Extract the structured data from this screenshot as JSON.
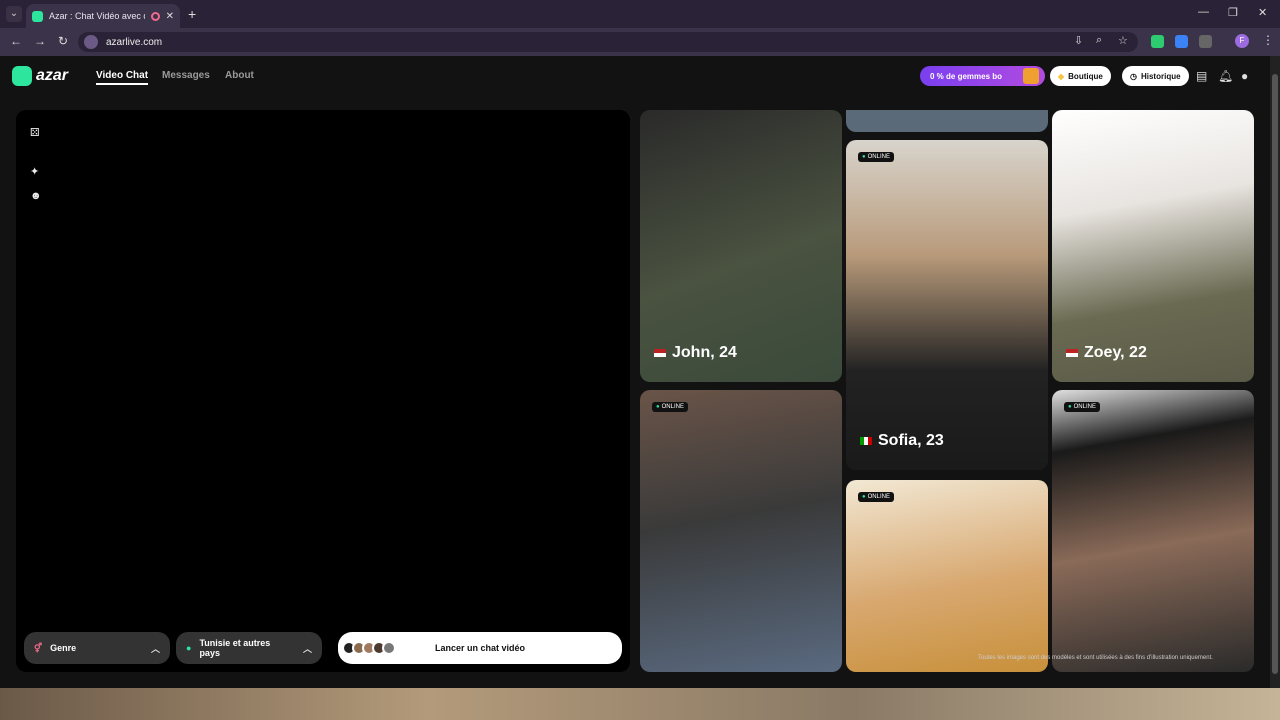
{
  "browser": {
    "tab_title": "Azar : Chat Vidéo avec de n",
    "url": "azarlive.com",
    "new_tab": "+",
    "profile_initial": "F"
  },
  "app": {
    "logo_text": "azar",
    "nav": [
      {
        "label": "Video Chat"
      },
      {
        "label": "Messages"
      },
      {
        "label": "About"
      }
    ],
    "promo_text": "0 % de gemmes bo",
    "shop_label": "Boutique",
    "history_label": "Historique"
  },
  "video_panel": {
    "gender_label": "Genre",
    "country_label": "Tunisie et autres pays",
    "launch_label": "Lancer un chat vidéo"
  },
  "cards": [
    {
      "name": "John, 24",
      "online": false
    },
    {
      "name": "Sofia, 23",
      "online": true
    },
    {
      "name": "Zoey, 22",
      "online": false
    },
    {
      "name": "",
      "online": true
    },
    {
      "name": "",
      "online": true
    },
    {
      "name": "",
      "online": true
    }
  ],
  "online_label": "ONLINE",
  "disclaimer": "Toutes les images sont des modèles et sont utilisées à des fins d'illustration uniquement.",
  "colors": {
    "accent": "#2ee59d",
    "promo": "#8a3fe8"
  }
}
